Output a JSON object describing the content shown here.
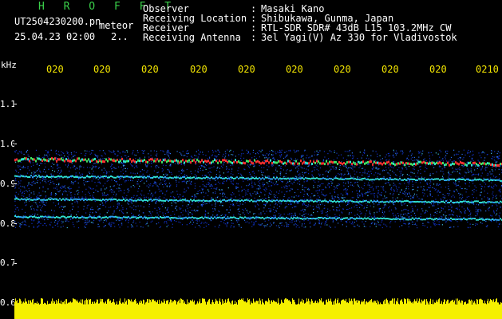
{
  "header": {
    "brand": "H R O F F T",
    "file_name": "UT2504230200.pn",
    "file_type": "meteor",
    "date_time": "25.04.23 02:00",
    "suffix": "2.."
  },
  "info": {
    "labels": [
      "Observer",
      "Receiving Location",
      "Receiver",
      "Receiving Antenna"
    ],
    "colon": ":",
    "values": [
      "Masaki Kano",
      "Shibukawa, Gunma, Japan",
      "RTL-SDR SDR# 43dB L15 103.2MHz CW",
      "3el Yagi(V) Az 330 for Vladivostok"
    ]
  },
  "chart_data": {
    "type": "heatmap",
    "ylabel": "kHz",
    "y_ticks": [
      "1.1",
      "1.0",
      "0.9",
      "0.8",
      "0.7",
      "0.6"
    ],
    "x_ticks": [
      "020",
      "020",
      "020",
      "020",
      "020",
      "020",
      "020",
      "020",
      "020",
      "0210"
    ],
    "ylim": [
      0.6,
      1.15
    ],
    "traces": [
      {
        "freq_start": 0.963,
        "freq_end": 0.951,
        "strength": "strong"
      },
      {
        "freq_start": 0.92,
        "freq_end": 0.91,
        "strength": "medium"
      },
      {
        "freq_start": 0.862,
        "freq_end": 0.855,
        "strength": "medium"
      },
      {
        "freq_start": 0.818,
        "freq_end": 0.812,
        "strength": "medium"
      }
    ],
    "noise_band": [
      0.79,
      0.985
    ],
    "bottom_bar": "amplitude",
    "colors": {
      "background": "#000000",
      "noise": "#1030c0",
      "trace": "#30e0d0",
      "peak": "#ff3030",
      "bar": "#f5f000",
      "tick": "#f2e400"
    }
  }
}
